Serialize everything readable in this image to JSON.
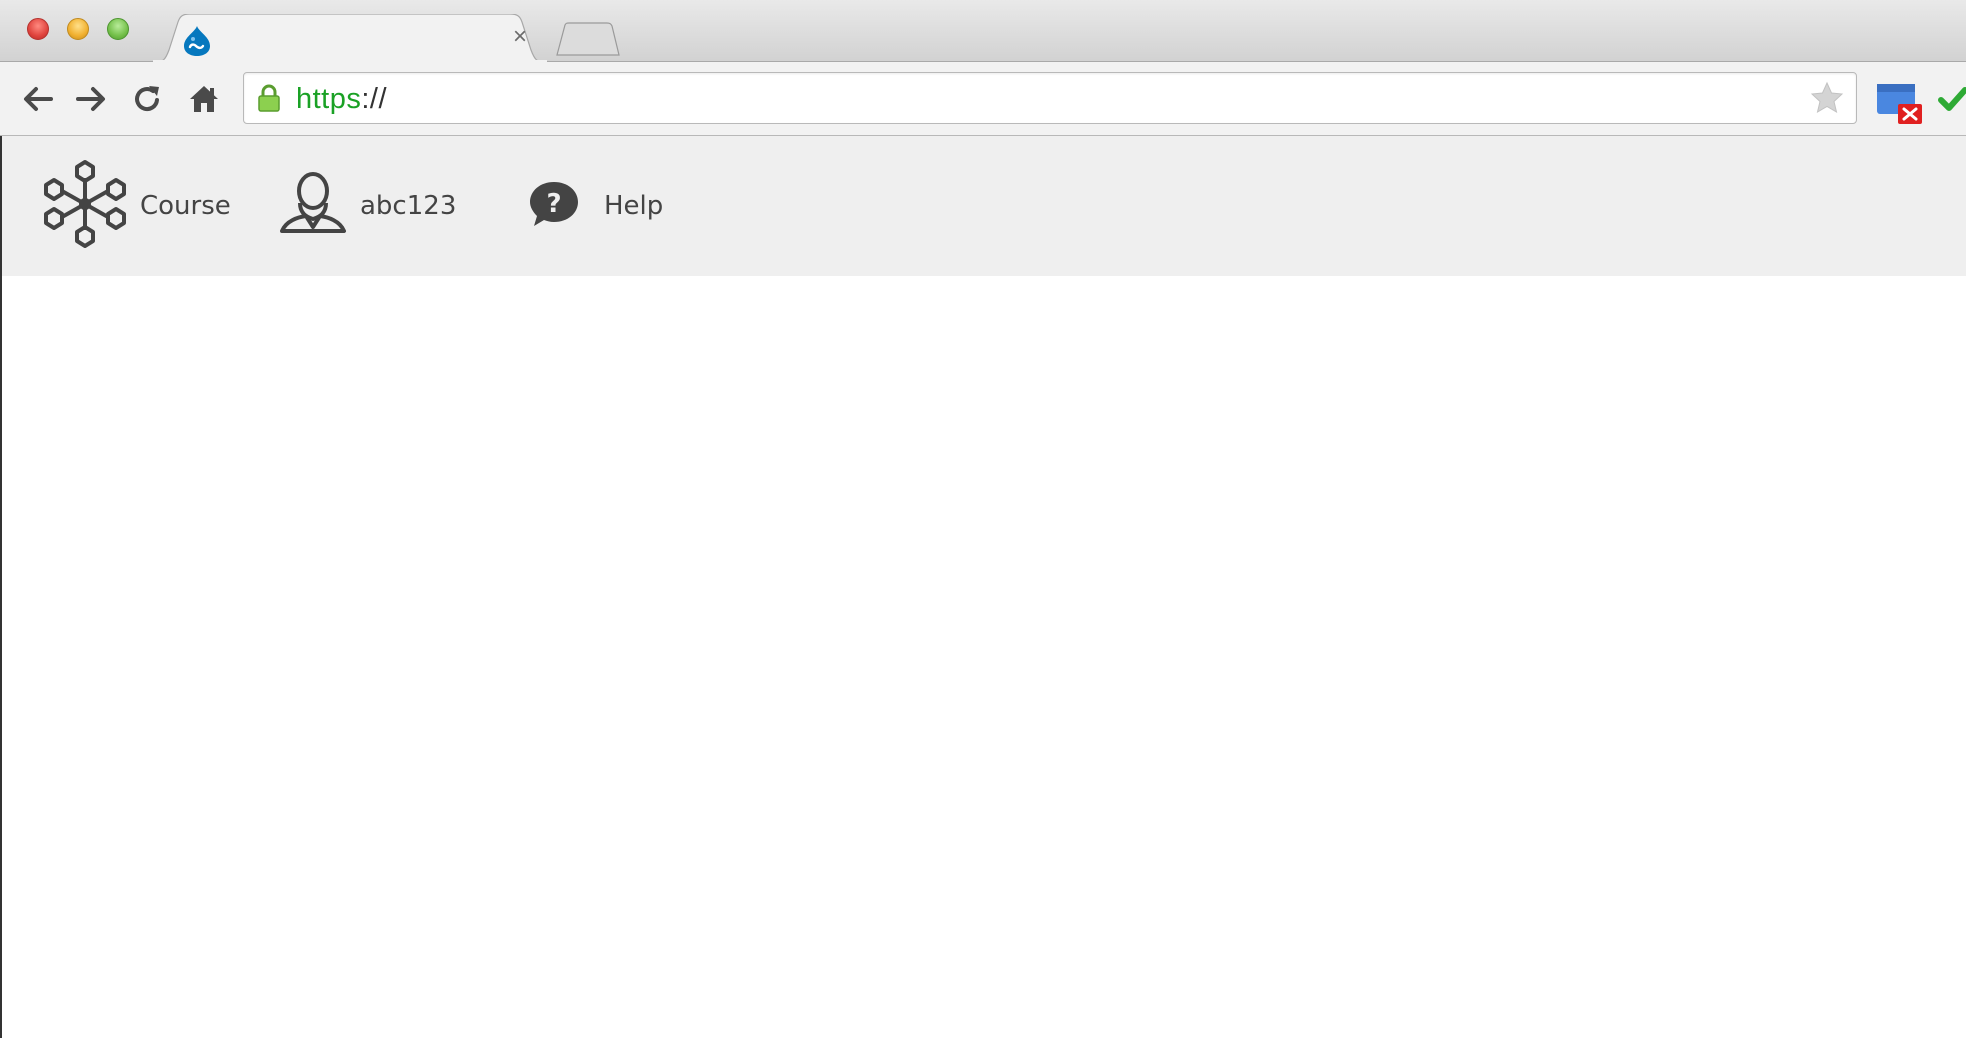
{
  "browser": {
    "tab": {
      "close_label": "×",
      "favicon": "drupal-drop-icon"
    },
    "address_bar": {
      "url_scheme": "https",
      "url_rest": "://"
    },
    "extensions": [
      "calendar-error-icon",
      "green-check-icon"
    ]
  },
  "site_nav": {
    "items": [
      {
        "label": "Course",
        "icon": "course-network-icon"
      },
      {
        "label": "abc123",
        "icon": "user-profile-icon"
      },
      {
        "label": "Help",
        "icon": "help-question-icon"
      }
    ]
  },
  "colors": {
    "url_scheme": "#1aa125",
    "header_bg": "#efefef",
    "nav_text": "#444444",
    "drupal_blue": "#0678be"
  }
}
